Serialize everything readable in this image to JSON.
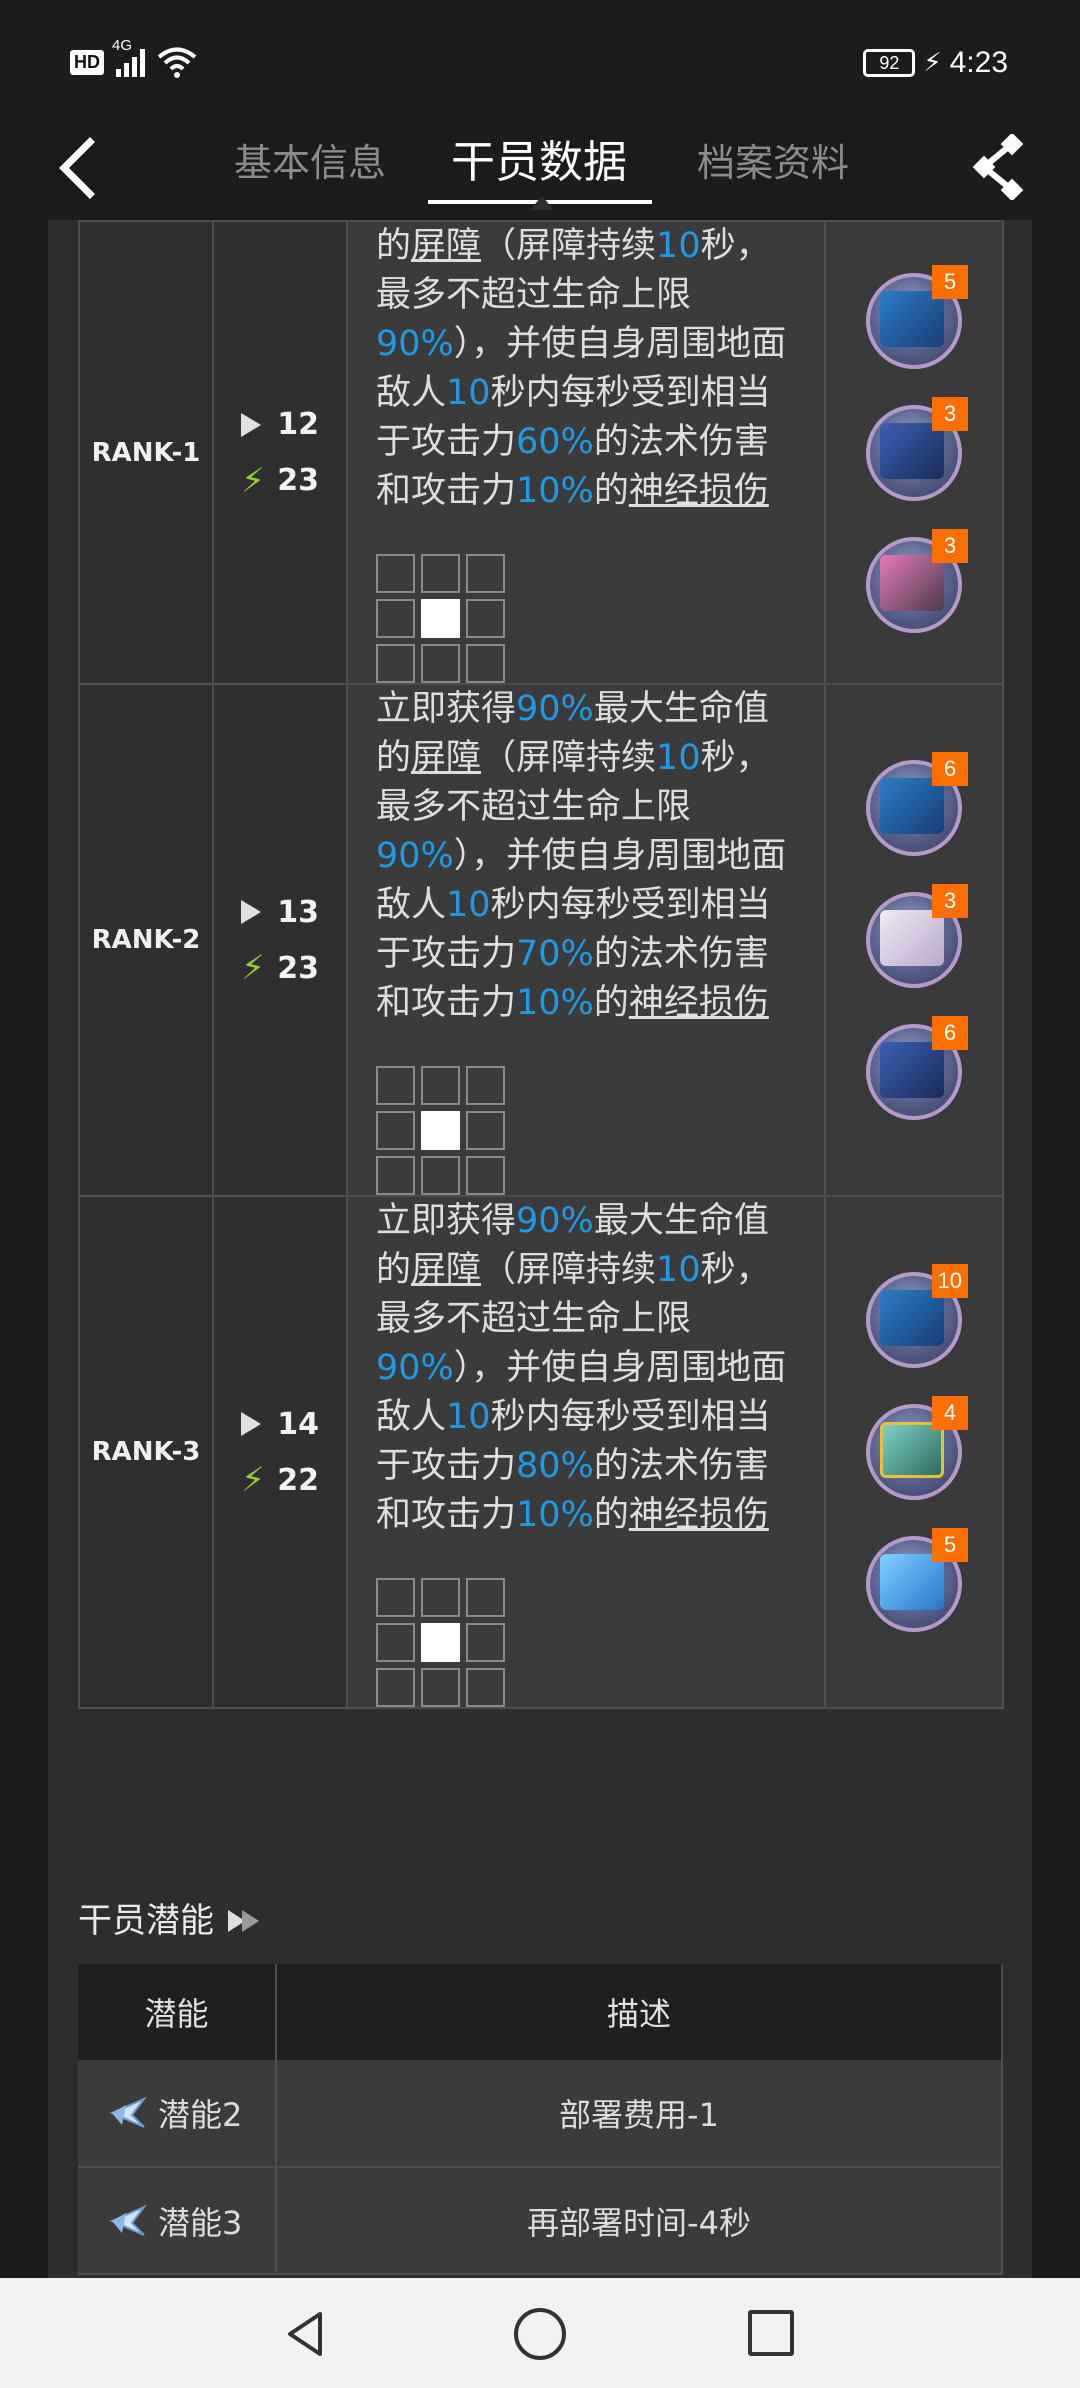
{
  "status_bar": {
    "hd": "HD",
    "network": "4G",
    "battery": "92",
    "time": "4:23"
  },
  "tabs": [
    {
      "label": "基本信息"
    },
    {
      "label": "干员数据"
    },
    {
      "label": "档案资料"
    }
  ],
  "ranks": [
    {
      "name": "RANK-1",
      "sp_init": "12",
      "sp_cost": "23",
      "desc": [
        {
          "t": "的"
        },
        {
          "t": "屏障",
          "ul": true
        },
        {
          "t": "（屏障持续"
        },
        {
          "t": "10",
          "hl": true
        },
        {
          "t": "秒，最多不超过生命上限"
        },
        {
          "t": "90%",
          "hl": true
        },
        {
          "t": "），并使自身周围地面敌人"
        },
        {
          "t": "10",
          "hl": true
        },
        {
          "t": "秒内每秒受到相当于攻击力"
        },
        {
          "t": "60%",
          "hl": true
        },
        {
          "t": "的法术伤害和攻击力"
        },
        {
          "t": "10%",
          "hl": true
        },
        {
          "t": "的"
        },
        {
          "t": "神经损伤",
          "ul": true
        }
      ],
      "materials": [
        {
          "icon": "chip-icon",
          "type": "t1",
          "count": "5"
        },
        {
          "icon": "device-icon",
          "type": "t5",
          "count": "3"
        },
        {
          "icon": "oriron-icon",
          "type": "t3",
          "count": "3"
        }
      ]
    },
    {
      "name": "RANK-2",
      "sp_init": "13",
      "sp_cost": "23",
      "desc": [
        {
          "t": "立即获得"
        },
        {
          "t": "90%",
          "hl": true
        },
        {
          "t": "最大生命值的"
        },
        {
          "t": "屏障",
          "ul": true
        },
        {
          "t": "（屏障持续"
        },
        {
          "t": "10",
          "hl": true
        },
        {
          "t": "秒，最多不超过生命上限"
        },
        {
          "t": "90%",
          "hl": true
        },
        {
          "t": "），并使自身周围地面敌人"
        },
        {
          "t": "10",
          "hl": true
        },
        {
          "t": "秒内每秒受到相当于攻击力"
        },
        {
          "t": "70%",
          "hl": true
        },
        {
          "t": "的法术伤害和攻击力"
        },
        {
          "t": "10%",
          "hl": true
        },
        {
          "t": "的"
        },
        {
          "t": "神经损伤",
          "ul": true
        }
      ],
      "materials": [
        {
          "icon": "chip-icon",
          "type": "t1",
          "count": "6"
        },
        {
          "icon": "polyester-icon",
          "type": "t4",
          "count": "3"
        },
        {
          "icon": "device-icon",
          "type": "t5",
          "count": "6"
        }
      ]
    },
    {
      "name": "RANK-3",
      "sp_init": "14",
      "sp_cost": "22",
      "desc": [
        {
          "t": "立即获得"
        },
        {
          "t": "90%",
          "hl": true
        },
        {
          "t": "最大生命值的"
        },
        {
          "t": "屏障",
          "ul": true
        },
        {
          "t": "（屏障持续"
        },
        {
          "t": "10",
          "hl": true
        },
        {
          "t": "秒，最多不超过生命上限"
        },
        {
          "t": "90%",
          "hl": true
        },
        {
          "t": "），并使自身周围地面敌人"
        },
        {
          "t": "10",
          "hl": true
        },
        {
          "t": "秒内每秒受到相当于攻击力"
        },
        {
          "t": "80%",
          "hl": true
        },
        {
          "t": "的法术伤害和攻击力"
        },
        {
          "t": "10%",
          "hl": true
        },
        {
          "t": "的"
        },
        {
          "t": "神经损伤",
          "ul": true
        }
      ],
      "materials": [
        {
          "icon": "chip-icon",
          "type": "t1",
          "count": "10"
        },
        {
          "icon": "gel-icon",
          "type": "t6",
          "count": "4"
        },
        {
          "icon": "crystal-icon",
          "type": "t7",
          "count": "5"
        }
      ]
    }
  ],
  "potential": {
    "section_title": "干员潜能",
    "headers": {
      "col1": "潜能",
      "col2": "描述"
    },
    "rows": [
      {
        "label": "潜能2",
        "desc": "部署费用-1"
      },
      {
        "label": "潜能3",
        "desc": "再部署时间-4秒"
      }
    ]
  }
}
